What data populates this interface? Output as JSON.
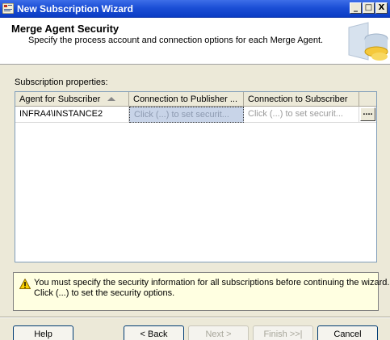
{
  "window": {
    "title": "New Subscription Wizard",
    "controls": {
      "minimize": "_",
      "maximize": "□",
      "close": "X"
    }
  },
  "header": {
    "title": "Merge Agent Security",
    "subtitle": "Specify the process account and connection options for each Merge Agent."
  },
  "properties": {
    "label": "Subscription properties:",
    "columns": [
      "Agent for Subscriber",
      "Connection to Publisher ...",
      "Connection to Subscriber",
      ""
    ],
    "rows": [
      {
        "agent": "INFRA4\\INSTANCE2",
        "publisher": "Click (...) to set securit...",
        "subscriber": "Click (...) to set securit...",
        "button": "...."
      }
    ]
  },
  "warning": {
    "icon": "warning-icon",
    "line1": "You must specify the security information for all subscriptions before continuing the wizard.",
    "line2": "Click (...) to set the security options."
  },
  "buttons": {
    "help": "Help",
    "back": "< Back",
    "next": "Next >",
    "finish": "Finish >>|",
    "cancel": "Cancel"
  }
}
